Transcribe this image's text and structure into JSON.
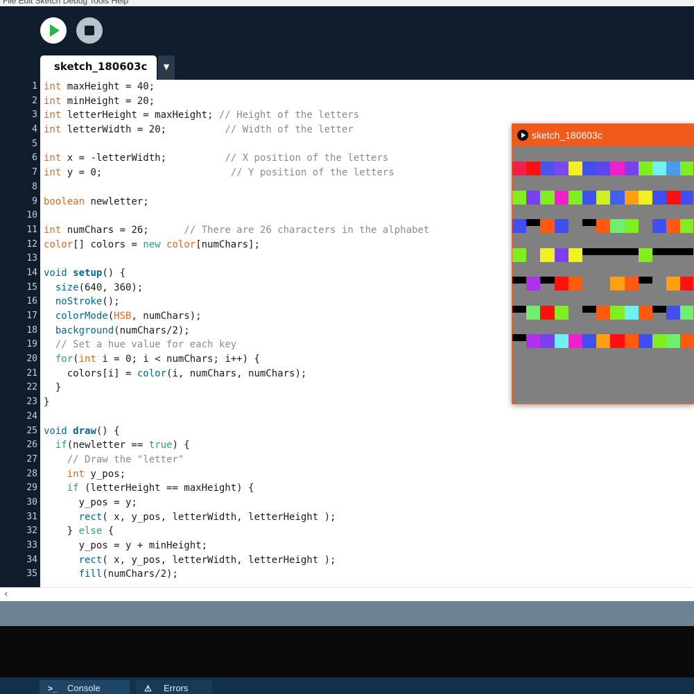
{
  "menubar": {
    "text": "File Edit Sketch Debug Tools Help"
  },
  "toolbar": {
    "run": "run",
    "stop": "stop"
  },
  "tab": {
    "name": "sketch_180603c",
    "menu_arrow": "▼"
  },
  "code": [
    [
      [
        "kw",
        "int"
      ],
      [
        "t",
        " maxHeight = 40;"
      ]
    ],
    [
      [
        "kw",
        "int"
      ],
      [
        "t",
        " minHeight = 20;"
      ]
    ],
    [
      [
        "kw",
        "int"
      ],
      [
        "t",
        " letterHeight = maxHeight; "
      ],
      [
        "cm",
        "// Height of the letters"
      ]
    ],
    [
      [
        "kw",
        "int"
      ],
      [
        "t",
        " letterWidth = 20;          "
      ],
      [
        "cm",
        "// Width of the letter"
      ]
    ],
    [],
    [
      [
        "kw",
        "int"
      ],
      [
        "t",
        " x = -letterWidth;          "
      ],
      [
        "cm",
        "// X position of the letters"
      ]
    ],
    [
      [
        "kw",
        "int"
      ],
      [
        "t",
        " y = 0;                      "
      ],
      [
        "cm",
        "// Y position of the letters"
      ]
    ],
    [],
    [
      [
        "kw",
        "boolean"
      ],
      [
        "t",
        " newletter;"
      ]
    ],
    [],
    [
      [
        "kw",
        "int"
      ],
      [
        "t",
        " numChars = 26;      "
      ],
      [
        "cm",
        "// There are 26 characters in the alphabet"
      ]
    ],
    [
      [
        "kw",
        "color"
      ],
      [
        "t",
        "[] colors = "
      ],
      [
        "lit",
        "new"
      ],
      [
        "t",
        " "
      ],
      [
        "kw",
        "color"
      ],
      [
        "t",
        "[numChars];"
      ]
    ],
    [],
    [
      [
        "fn",
        "void"
      ],
      [
        "t",
        " "
      ],
      [
        "fnb",
        "setup"
      ],
      [
        "t",
        "() {"
      ]
    ],
    [
      [
        "t",
        "  "
      ],
      [
        "fn",
        "size"
      ],
      [
        "t",
        "(640, 360);"
      ]
    ],
    [
      [
        "t",
        "  "
      ],
      [
        "fn",
        "noStroke"
      ],
      [
        "t",
        "();"
      ]
    ],
    [
      [
        "t",
        "  "
      ],
      [
        "fn",
        "colorMode"
      ],
      [
        "t",
        "("
      ],
      [
        "kw",
        "HSB"
      ],
      [
        "t",
        ", numChars);"
      ]
    ],
    [
      [
        "t",
        "  "
      ],
      [
        "fn",
        "background"
      ],
      [
        "t",
        "(numChars/2);"
      ]
    ],
    [
      [
        "t",
        "  "
      ],
      [
        "cm",
        "// Set a hue value for each key"
      ]
    ],
    [
      [
        "t",
        "  "
      ],
      [
        "lit",
        "for"
      ],
      [
        "t",
        "("
      ],
      [
        "kw",
        "int"
      ],
      [
        "t",
        " i = 0; i < numChars; i++) {"
      ]
    ],
    [
      [
        "t",
        "    colors[i] = "
      ],
      [
        "fn",
        "color"
      ],
      [
        "t",
        "(i, numChars, numChars);"
      ]
    ],
    [
      [
        "t",
        "  }"
      ]
    ],
    [
      [
        "t",
        "}"
      ]
    ],
    [],
    [
      [
        "fn",
        "void"
      ],
      [
        "t",
        " "
      ],
      [
        "fnb",
        "draw"
      ],
      [
        "t",
        "() {"
      ]
    ],
    [
      [
        "t",
        "  "
      ],
      [
        "lit",
        "if"
      ],
      [
        "t",
        "(newletter == "
      ],
      [
        "lit",
        "true"
      ],
      [
        "t",
        ") {"
      ]
    ],
    [
      [
        "t",
        "    "
      ],
      [
        "cm",
        "// Draw the \"letter\""
      ]
    ],
    [
      [
        "t",
        "    "
      ],
      [
        "kw",
        "int"
      ],
      [
        "t",
        " y_pos;"
      ]
    ],
    [
      [
        "t",
        "    "
      ],
      [
        "lit",
        "if"
      ],
      [
        "t",
        " (letterHeight == maxHeight) {"
      ]
    ],
    [
      [
        "t",
        "      y_pos = y;"
      ]
    ],
    [
      [
        "t",
        "      "
      ],
      [
        "fn",
        "rect"
      ],
      [
        "t",
        "( x, y_pos, letterWidth, letterHeight );"
      ]
    ],
    [
      [
        "t",
        "    } "
      ],
      [
        "lit",
        "else"
      ],
      [
        "t",
        " {"
      ]
    ],
    [
      [
        "t",
        "      y_pos = y + minHeight;"
      ]
    ],
    [
      [
        "t",
        "      "
      ],
      [
        "fn",
        "rect"
      ],
      [
        "t",
        "( x, y_pos, letterWidth, letterHeight );"
      ]
    ],
    [
      [
        "t",
        "      "
      ],
      [
        "fn",
        "fill"
      ],
      [
        "t",
        "(numChars/2);"
      ]
    ]
  ],
  "hscroll": {
    "left_arrow": "‹"
  },
  "console_tabs": {
    "console": "Console",
    "errors": "Errors"
  },
  "sketch_window": {
    "title": "sketch_180603c",
    "rows": [
      {
        "tall": [
          "#f0204a",
          "#ff1010",
          "#4a55ee",
          "#7a48ee",
          "#f2f020",
          "#4050ee",
          "#5a48ee",
          "#ee20cc",
          "#7a40ee",
          "#80ee20",
          "#70f0ee",
          "#4a9aee",
          "#80ee20"
        ]
      },
      {
        "tall": [
          "#80ee20",
          "#7a40ee",
          "#80ee20",
          "#ee20cc",
          "#80ee20",
          "#4050ee",
          "#d0ee20",
          "#4060ee",
          "#ffa010",
          "#f2f020",
          "#4050ee",
          "#ff1010",
          "#4050ee"
        ]
      },
      {
        "tall": [
          "#4050ee",
          null,
          "#ff5a10",
          "#4050ee",
          null,
          null,
          "#ff5a10",
          "#70ee70",
          "#80ee20",
          null,
          "#4050ee",
          "#ff5a10",
          "#80ee20"
        ],
        "short": [
          "#4050ee",
          "#000000",
          "#ff5a10",
          "#4050ee",
          null,
          "#000000",
          "#ff5a10",
          "#70ee70",
          "#80ee20",
          null,
          "#4050ee",
          "#ff5a10",
          "#80ee20"
        ]
      },
      {
        "tall": [
          "#80ee20",
          null,
          "#f2f020",
          "#7a40ee",
          "#f2f020",
          null,
          null,
          null,
          null,
          "#80ee20",
          null,
          null,
          null
        ],
        "short": [
          "#80ee20",
          null,
          "#f2f020",
          "#7a40ee",
          "#f2f020",
          "#000000",
          "#000000",
          "#000000",
          "#000000",
          "#80ee20",
          "#000000",
          "#000000",
          "#000000"
        ]
      },
      {
        "tall": [
          null,
          "#b030ee",
          null,
          "#ff1010",
          "#ff5a10",
          null,
          null,
          "#ffa010",
          "#ff5a10",
          null,
          null,
          "#ffa010",
          "#ff1010"
        ],
        "short": [
          "#000000",
          "#b030ee",
          "#000000",
          "#ff1010",
          "#ff5a10",
          null,
          null,
          "#ffa010",
          "#ff5a10",
          "#000000",
          null,
          "#ffa010",
          "#ff1010"
        ]
      },
      {
        "tall": [
          null,
          "#70ee70",
          "#ff1010",
          "#80ee20",
          null,
          null,
          "#ff5a10",
          "#80ee20",
          "#70f0ee",
          "#ff5a10",
          null,
          "#4050ee",
          "#70ee70"
        ],
        "short": [
          "#000000",
          "#70ee70",
          "#ff1010",
          "#80ee20",
          null,
          "#000000",
          "#ff5a10",
          "#80ee20",
          "#70f0ee",
          "#ff5a10",
          "#000000",
          "#4050ee",
          "#70ee70"
        ]
      },
      {
        "tall": [
          null,
          "#b030ee",
          "#7a40ee",
          "#70f0ee",
          "#ee20cc",
          "#4050ee",
          "#ffa010",
          "#ff1010",
          "#ff5a10",
          "#4050ee",
          "#80ee20",
          "#70ee70",
          "#ff5a10"
        ],
        "short": [
          "#000000",
          "#b030ee",
          "#7a40ee",
          "#70f0ee",
          "#ee20cc",
          "#4050ee",
          "#ffa010",
          "#ff1010",
          "#ff5a10",
          "#4050ee",
          "#80ee20",
          "#70ee70",
          "#ff5a10"
        ]
      }
    ]
  }
}
